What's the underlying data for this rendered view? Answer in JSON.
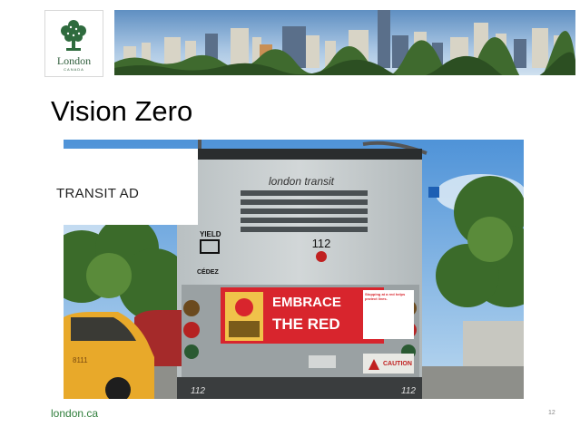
{
  "header": {
    "logo_name": "London",
    "logo_sub": "CANADA"
  },
  "slide": {
    "title": "Vision Zero",
    "label": "TRANSIT AD"
  },
  "bus": {
    "brand": "london transit",
    "number": "112",
    "yield_top": "YIELD",
    "yield_bottom": "CÉDEZ",
    "ad_line1": "EMBRACE",
    "ad_line2": "THE RED",
    "ad_note": "Stopping at a red helps protect lives.",
    "caution": "CAUTION",
    "plate_left": "112",
    "plate_right": "112",
    "taxi_text": "8111"
  },
  "footer": {
    "url": "london.ca",
    "page": "12"
  },
  "colors": {
    "brand_green": "#2e7d3a",
    "ad_red": "#d8252d",
    "taxi_yellow": "#e8a92a"
  }
}
